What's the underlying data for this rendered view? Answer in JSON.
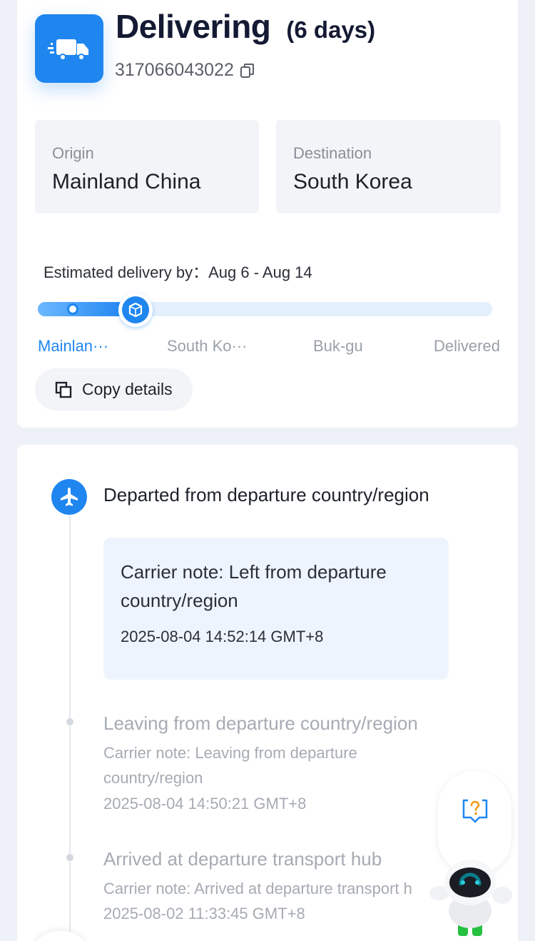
{
  "header": {
    "status": "Delivering",
    "duration": "(6 days)",
    "tracking_number": "317066043022"
  },
  "origin": {
    "label": "Origin",
    "value": "Mainland China"
  },
  "destination": {
    "label": "Destination",
    "value": "South Korea"
  },
  "eta": {
    "text": "Estimated delivery by：Aug 6 - Aug 14"
  },
  "progress": {
    "fraction": 0.2
  },
  "stages": [
    "Mainlan···",
    "South Ko···",
    "Buk-gu",
    "Delivered"
  ],
  "copy_details_label": "Copy details",
  "events": [
    {
      "title": "Departed from departure country/region",
      "note": "Carrier note: Left from departure country/region",
      "time": "2025-08-04 14:52:14 GMT+8"
    },
    {
      "title": "Leaving from departure country/region",
      "note": "Carrier note: Leaving from departure country/region",
      "time": "2025-08-04 14:50:21 GMT+8"
    },
    {
      "title": "Arrived at departure transport hub",
      "note": "Carrier note: Arrived at departure transport h",
      "time": "2025-08-02 11:33:45 GMT+8"
    }
  ],
  "colors": {
    "accent": "#1f86f0",
    "muted": "#a6abb3",
    "robot_screen": "#0a7d8c"
  },
  "icons": [
    "truck-icon",
    "copy-icon",
    "box-icon",
    "plane-icon",
    "help-icon"
  ]
}
